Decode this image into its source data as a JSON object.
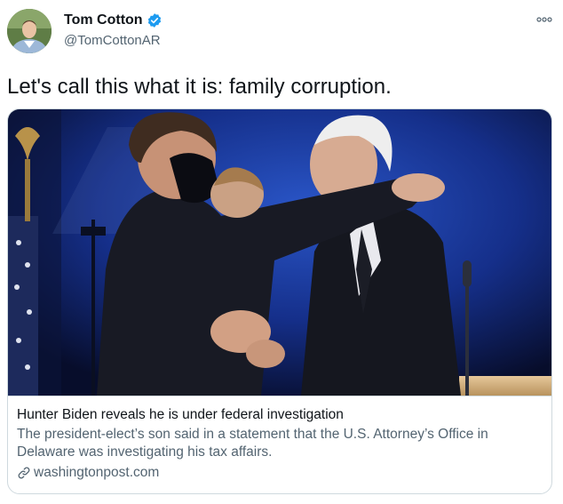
{
  "author": {
    "name": "Tom Cotton",
    "handle": "@TomCottonAR",
    "verified": true
  },
  "more_icon": "more-options-icon",
  "tweet": {
    "text": "Let's call this what it is: family corruption."
  },
  "card": {
    "title": "Hunter Biden reveals he is under federal investigation",
    "description": "The president-elect’s son said in a statement that the U.S. Attorney’s Office in Delaware was investigating his tax affairs.",
    "domain": "washingtonpost.com",
    "domain_icon": "link-icon"
  },
  "colors": {
    "verified_blue": "#1d9bf0",
    "secondary_text": "#536471",
    "border": "#cfd9de"
  }
}
